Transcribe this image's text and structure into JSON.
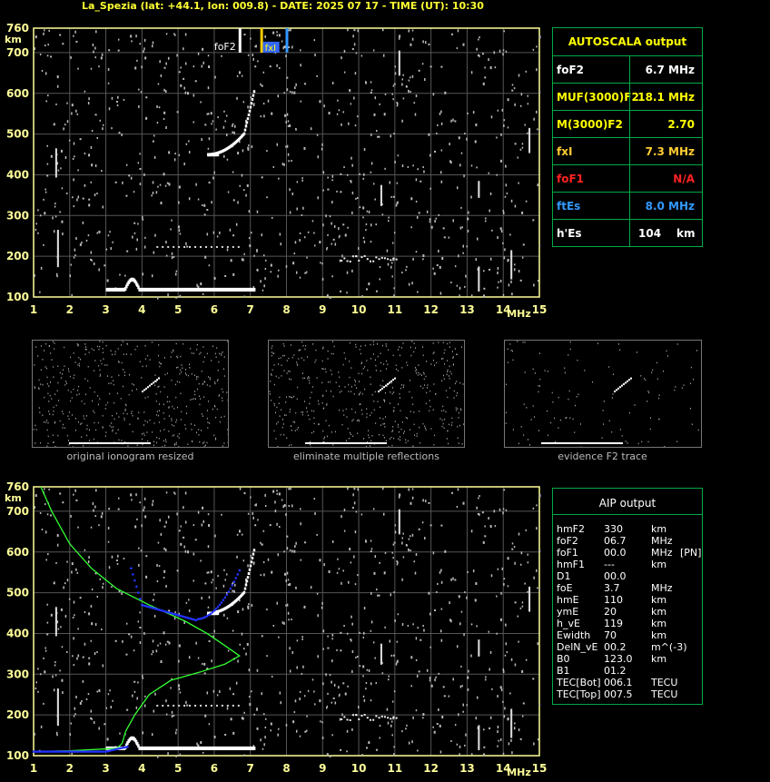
{
  "header": {
    "title": "La_Spezia (lat: +44.1, lon: 009.8) - DATE: 2025 07 17 - TIME (UT): 10:30"
  },
  "colors": {
    "grid": "#555555",
    "axis": "#ffff99",
    "accent": "#ffff00",
    "panel_border": "#00aa44",
    "fof2_marker": "#ffffff",
    "fxi_marker": "#ffcc00",
    "fes_marker": "#3399ff",
    "profile_line": "#33ff33",
    "trace_points": "#2233ff"
  },
  "ionogram_top": {
    "y_unit": "km",
    "x_unit": "MHz",
    "y_ticks": [
      "760",
      "700",
      "600",
      "500",
      "400",
      "300",
      "200",
      "100"
    ],
    "x_ticks": [
      "1",
      "2",
      "3",
      "4",
      "5",
      "6",
      "7",
      "8",
      "9",
      "10",
      "11",
      "12",
      "13",
      "14",
      "15"
    ],
    "markers": {
      "fof2_label": "foF2",
      "fxi_label": "fxI"
    }
  },
  "autoscala": {
    "title": "AUTOSCALA output",
    "rows": [
      {
        "label": "foF2",
        "value": "6.7 MHz",
        "color": "#ffffff",
        "value_color": "#ffffff"
      },
      {
        "label": "MUF(3000)F2",
        "value": "18.1 MHz",
        "color": "#ffff00",
        "value_color": "#ffff00"
      },
      {
        "label": "M(3000)F2",
        "value": "2.70",
        "color": "#ffff00",
        "value_color": "#ffff00"
      },
      {
        "label": "fxI",
        "value": "7.3 MHz",
        "color": "#ffcc33",
        "value_color": "#ffcc33"
      },
      {
        "label": "foF1",
        "value": "N/A",
        "color": "#ff2222",
        "value_color": "#ff2222"
      },
      {
        "label": "ftEs",
        "value": "8.0 MHz",
        "color": "#3399ff",
        "value_color": "#3399ff"
      },
      {
        "label": "h'Es",
        "value": "104",
        "unit": "km",
        "color": "#ffffff",
        "value_color": "#ffffff"
      }
    ]
  },
  "thumbnails": [
    {
      "caption": "original ionogram resized"
    },
    {
      "caption": "eliminate multiple reflections"
    },
    {
      "caption": "evidence F2 trace"
    }
  ],
  "ionogram_bottom": {
    "y_unit": "km",
    "x_unit": "MHz",
    "y_ticks": [
      "760",
      "700",
      "600",
      "500",
      "400",
      "300",
      "200",
      "100"
    ],
    "x_ticks": [
      "1",
      "2",
      "3",
      "4",
      "5",
      "6",
      "7",
      "8",
      "9",
      "10",
      "11",
      "12",
      "13",
      "14",
      "15"
    ]
  },
  "aip": {
    "title": "AIP output",
    "rows": [
      {
        "name": "hmF2",
        "value": "330",
        "unit": "km",
        "extra": ""
      },
      {
        "name": "foF2",
        "value": "06.7",
        "unit": "MHz",
        "extra": ""
      },
      {
        "name": "foF1",
        "value": "00.0",
        "unit": "MHz",
        "extra": "[PN]"
      },
      {
        "name": "hmF1",
        "value": "---",
        "unit": "km",
        "extra": ""
      },
      {
        "name": "D1",
        "value": "00.0",
        "unit": "",
        "extra": ""
      },
      {
        "name": "foE",
        "value": "3.7",
        "unit": "MHz",
        "extra": ""
      },
      {
        "name": "hmE",
        "value": "110",
        "unit": "km",
        "extra": ""
      },
      {
        "name": "ymE",
        "value": "20",
        "unit": "km",
        "extra": ""
      },
      {
        "name": "h_vE",
        "value": "119",
        "unit": "km",
        "extra": ""
      },
      {
        "name": "Ewidth",
        "value": "70",
        "unit": "km",
        "extra": ""
      },
      {
        "name": "DelN_vE",
        "value": "00.2",
        "unit": "m^(-3)",
        "extra": ""
      },
      {
        "name": "B0",
        "value": "123.0",
        "unit": "km",
        "extra": ""
      },
      {
        "name": "B1",
        "value": "01.2",
        "unit": "",
        "extra": ""
      },
      {
        "name": "TEC[Bot]",
        "value": "006.1",
        "unit": "TECU",
        "extra": ""
      },
      {
        "name": "TEC[Top]",
        "value": "007.5",
        "unit": "TECU",
        "extra": ""
      }
    ]
  }
}
